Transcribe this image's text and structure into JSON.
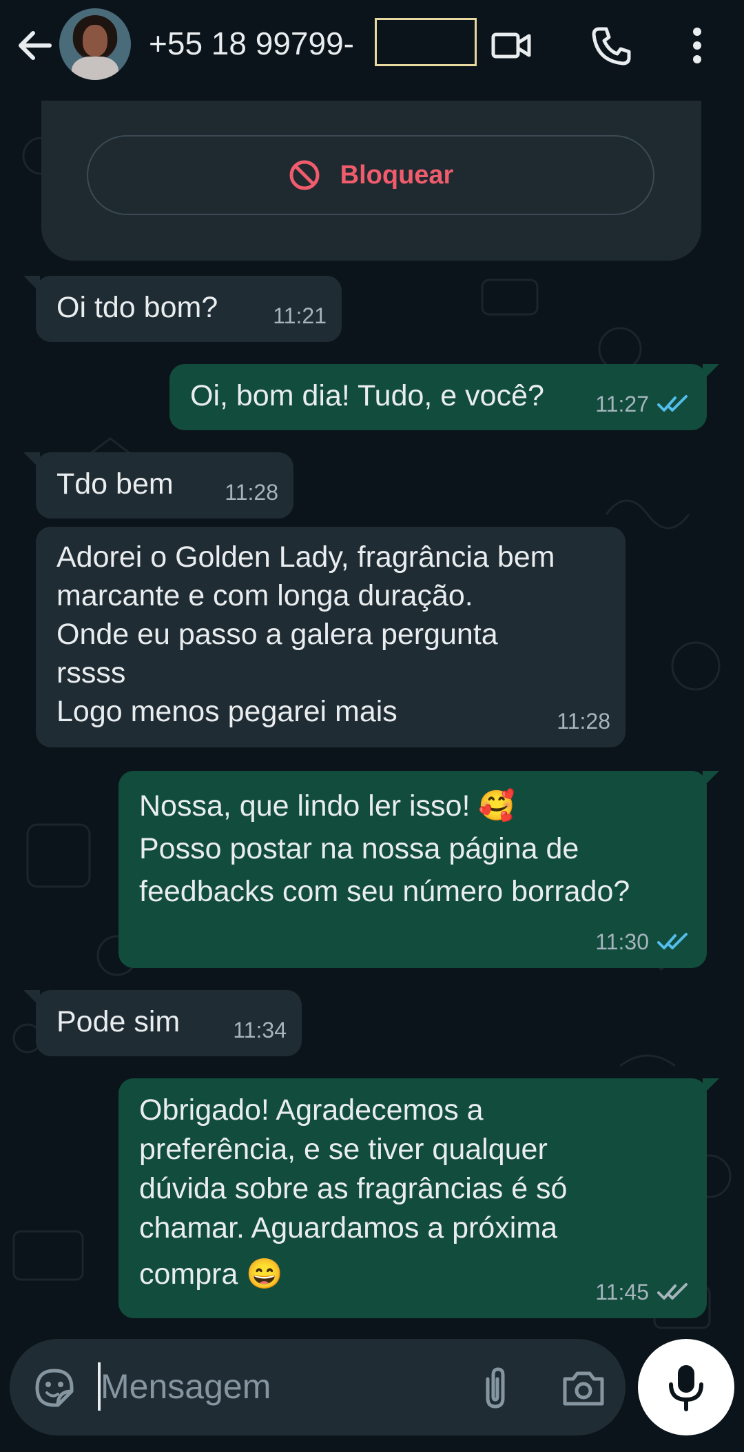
{
  "header": {
    "title": "+55 18 99799-",
    "icons": [
      "back-arrow-icon",
      "video-call-icon",
      "phone-icon",
      "more-vert-icon"
    ]
  },
  "info_card": {
    "block_label": "Bloquear",
    "block_color": "#f15c6d"
  },
  "messages": [
    {
      "dir": "in",
      "text": "Oi tdo bom?",
      "time": "11:21"
    },
    {
      "dir": "out",
      "text": "Oi, bom dia! Tudo, e você?",
      "time": "11:27",
      "status": "read"
    },
    {
      "dir": "in",
      "text": "Tdo bem",
      "time": "11:28"
    },
    {
      "dir": "in",
      "lines": [
        "Adorei o Golden Lady, fragrância bem",
        "marcante e com longa duração.",
        "Onde eu passo a galera pergunta",
        "rssss",
        "Logo menos pegarei mais"
      ],
      "time": "11:28"
    },
    {
      "dir": "out",
      "lines": [
        "Nossa, que lindo ler isso! 🥰",
        "Posso postar na nossa página de",
        "feedbacks com seu número borrado?"
      ],
      "time": "11:30",
      "status": "read"
    },
    {
      "dir": "in",
      "text": "Pode sim",
      "time": "11:34"
    },
    {
      "dir": "out",
      "lines": [
        "Obrigado! Agradecemos a",
        "preferência, e se tiver qualquer",
        "dúvida sobre as fragrâncias é só",
        "chamar. Aguardamos a próxima",
        "compra 😄"
      ],
      "time": "11:45",
      "status": "delivered"
    }
  ],
  "input": {
    "placeholder": "Mensagem"
  },
  "colors": {
    "background": "#0b141a",
    "incoming_bubble": "#202c33",
    "outgoing_bubble": "#114c3d",
    "read_ticks": "#53bdeb",
    "delivered_ticks": "#a6b5bd"
  }
}
